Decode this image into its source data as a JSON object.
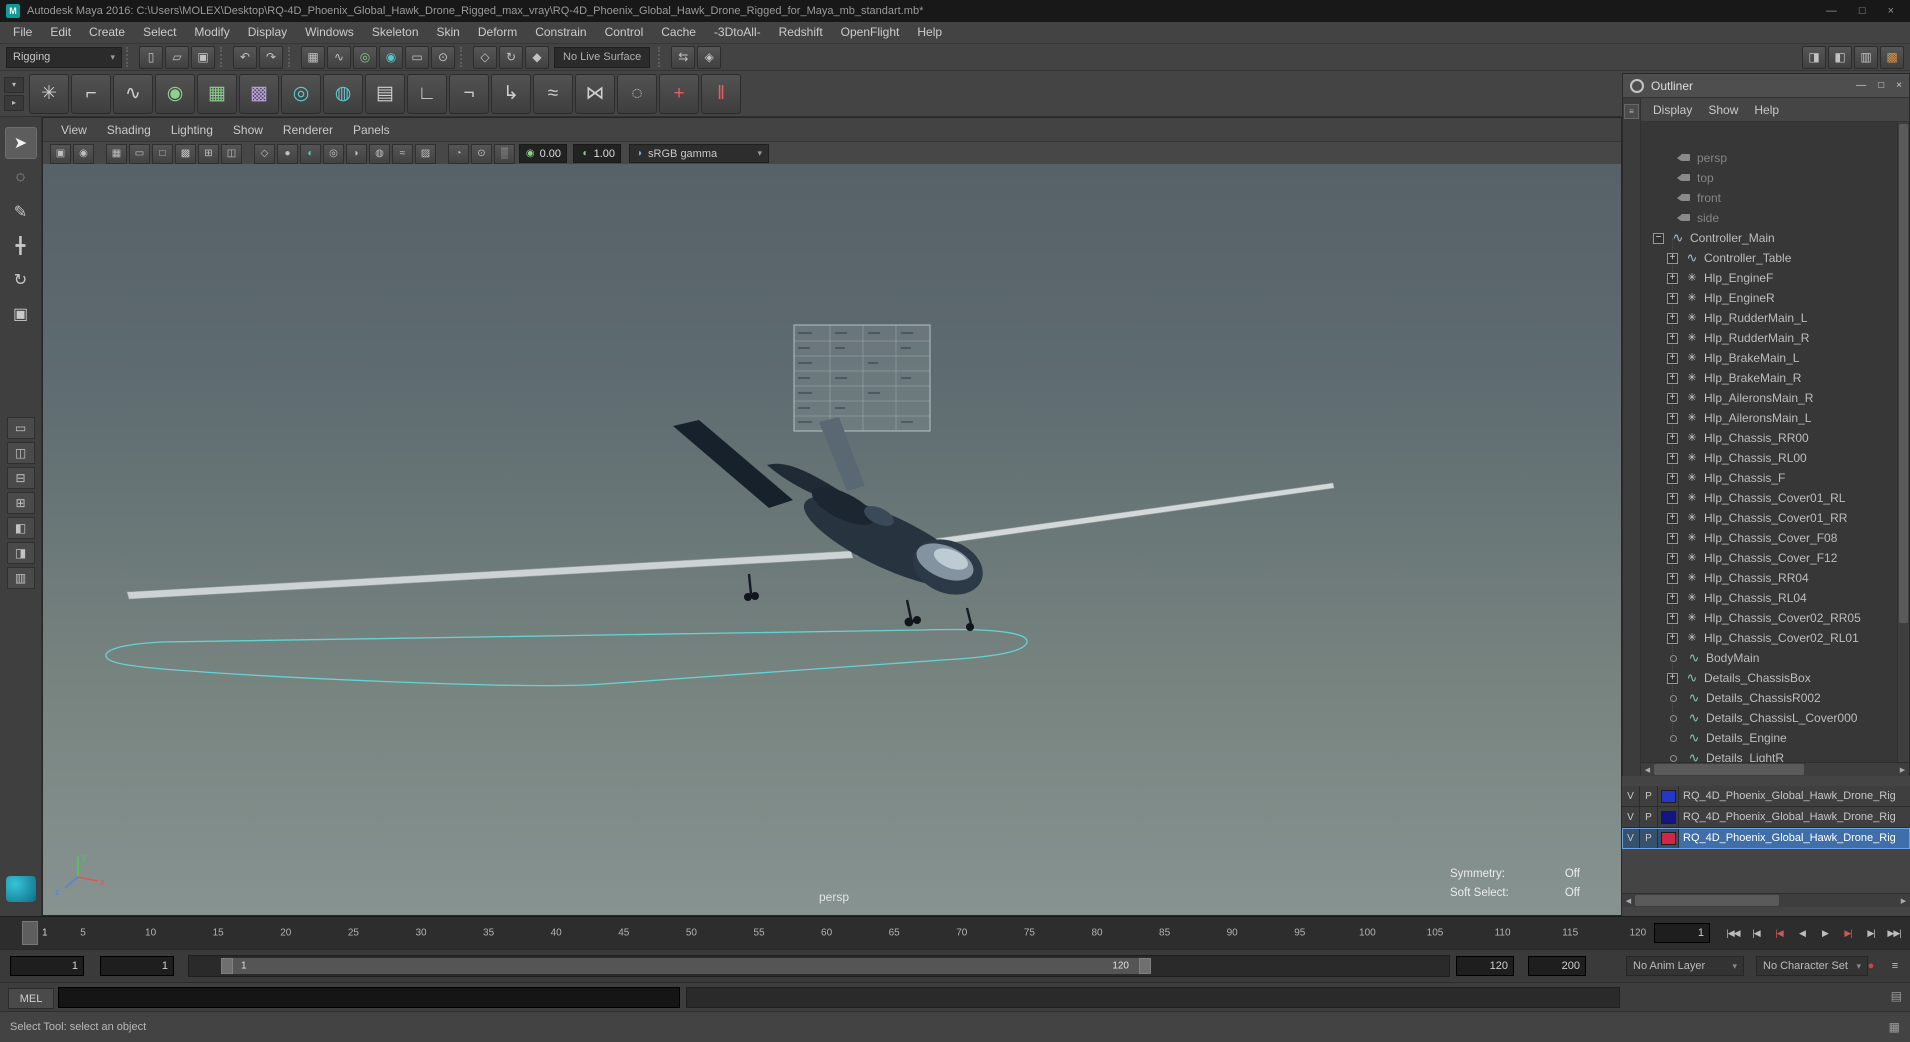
{
  "titlebar": {
    "title": "Autodesk Maya 2016: C:\\Users\\MOLEX\\Desktop\\RQ-4D_Phoenix_Global_Hawk_Drone_Rigged_max_vray\\RQ-4D_Phoenix_Global_Hawk_Drone_Rigged_for_Maya_mb_standart.mb*",
    "badge": "M",
    "minimize": "—",
    "maximize": "□",
    "close": "×"
  },
  "menubar": [
    "File",
    "Edit",
    "Create",
    "Select",
    "Modify",
    "Display",
    "Windows",
    "Skeleton",
    "Skin",
    "Deform",
    "Constrain",
    "Control",
    "Cache",
    "-3DtoAll-",
    "Redshift",
    "OpenFlight",
    "Help"
  ],
  "statusline": {
    "menuset": "Rigging",
    "items": [
      {
        "k": "sep"
      },
      {
        "k": "i",
        "n": "new-scene-icon",
        "g": "▯"
      },
      {
        "k": "i",
        "n": "open-scene-icon",
        "g": "▱"
      },
      {
        "k": "i",
        "n": "save-scene-icon",
        "g": "▣"
      },
      {
        "k": "sep"
      },
      {
        "k": "i",
        "n": "undo-icon",
        "g": "↶"
      },
      {
        "k": "i",
        "n": "redo-icon",
        "g": "↷"
      },
      {
        "k": "sep"
      },
      {
        "k": "i",
        "n": "snap-to-grids-icon",
        "g": "▦"
      },
      {
        "k": "i",
        "n": "snap-to-curves-icon",
        "g": "∿"
      },
      {
        "k": "i",
        "n": "snap-to-points-icon",
        "g": "◎",
        "t": "#7fcf7f"
      },
      {
        "k": "i",
        "n": "snap-to-projected-center-icon",
        "g": "◉",
        "t": "#56c8c8"
      },
      {
        "k": "i",
        "n": "snap-to-view-planes-icon",
        "g": "▭"
      },
      {
        "k": "i",
        "n": "make-object-live-icon",
        "g": "⊙"
      },
      {
        "k": "sep"
      },
      {
        "k": "i",
        "n": "inputs-to-selected-icon",
        "g": "◇"
      },
      {
        "k": "i",
        "n": "construction-history-icon",
        "g": "↻"
      },
      {
        "k": "i",
        "n": "outputs-from-selected-icon",
        "g": "◆"
      },
      {
        "k": "f",
        "n": "live-surface-field",
        "v": "No Live Surface"
      },
      {
        "k": "sep"
      },
      {
        "k": "i",
        "n": "symmetry-icon",
        "g": "⇆"
      },
      {
        "k": "i",
        "n": "highlight-selection-icon",
        "g": "◈"
      }
    ],
    "right_icons": [
      {
        "n": "attribute-editor-toggle-icon",
        "g": "◨"
      },
      {
        "n": "tool-settings-toggle-icon",
        "g": "◧"
      },
      {
        "n": "channel-box-toggle-icon",
        "g": "▥"
      },
      {
        "n": "modeling-toolkit-toggle-icon",
        "g": "▩",
        "t": "#d79343"
      }
    ]
  },
  "shelf": {
    "tabs": [
      {
        "n": "shelf-tab-selector-icon",
        "g": "▾"
      },
      {
        "n": "shelf-menu-icon",
        "g": "▸"
      }
    ],
    "icons": [
      {
        "n": "joint-tool-icon",
        "g": "✳"
      },
      {
        "n": "ik-handle-icon",
        "g": "⌐"
      },
      {
        "n": "ik-spline-icon",
        "g": "∿"
      },
      {
        "n": "quick-rig-icon",
        "g": "◉",
        "t": "#8fd08f"
      },
      {
        "n": "hik-skeleton-icon",
        "g": "▦",
        "t": "#8fd08f"
      },
      {
        "n": "hik-control-rig-icon",
        "g": "▩",
        "t": "#b89fe0"
      },
      {
        "n": "create-control-curve-icon",
        "g": "◎",
        "t": "#5fc9c9"
      },
      {
        "n": "geodesic-voxel-bind-icon",
        "g": "◍",
        "t": "#5fc9c9"
      },
      {
        "n": "bind-skin-icon",
        "g": "▤"
      },
      {
        "n": "unbind-skin-icon",
        "g": "∟"
      },
      {
        "n": "mirror-joint-icon",
        "g": "¬"
      },
      {
        "n": "orient-joint-icon",
        "g": "↳"
      },
      {
        "n": "paint-skin-weights-icon",
        "g": "≈"
      },
      {
        "n": "add-influence-icon",
        "g": "⋈"
      },
      {
        "n": "pose-editor-icon",
        "g": "◌"
      },
      {
        "n": "create-cluster-icon",
        "g": "+",
        "t": "#e06060"
      },
      {
        "n": "edit-membership-icon",
        "g": "‖",
        "t": "#e06060"
      }
    ]
  },
  "toolbox": {
    "tools": [
      {
        "n": "select-tool",
        "g": "➤",
        "active": true
      },
      {
        "n": "lasso-select-tool",
        "g": "◌"
      },
      {
        "n": "paint-select-tool",
        "g": "✎"
      },
      {
        "n": "move-tool",
        "g": "╋"
      },
      {
        "n": "rotate-tool",
        "g": "↻"
      },
      {
        "n": "scale-tool",
        "g": "▣"
      }
    ],
    "layouts": [
      {
        "n": "layout-single-pane",
        "g": "▭"
      },
      {
        "n": "layout-two-panes-side-by-side",
        "g": "◫"
      },
      {
        "n": "layout-two-panes-stacked",
        "g": "⊟"
      },
      {
        "n": "layout-four-panes",
        "g": "⊞"
      },
      {
        "n": "layout-three-panes-split-top",
        "g": "◧"
      },
      {
        "n": "layout-three-panes-split-left",
        "g": "◨"
      },
      {
        "n": "layout-outliner-persp",
        "g": "▥"
      }
    ]
  },
  "panel_menu": [
    "View",
    "Shading",
    "Lighting",
    "Show",
    "Renderer",
    "Panels"
  ],
  "viewport_bar": {
    "exposure": "0.00",
    "gamma": "1.00",
    "view_transform": "sRGB gamma",
    "groups": [
      [
        {
          "n": "select-camera-icon",
          "g": "▣"
        },
        {
          "n": "lock-camera-icon",
          "g": "◉"
        }
      ],
      [
        {
          "n": "grid-icon",
          "g": "▦"
        },
        {
          "n": "film-gate-icon",
          "g": "▭"
        },
        {
          "n": "resolution-gate-icon",
          "g": "□"
        },
        {
          "n": "gate-mask-icon",
          "g": "▩"
        },
        {
          "n": "field-chart-icon",
          "g": "⊞"
        },
        {
          "n": "safe-action-icon",
          "g": "◫"
        }
      ],
      [
        {
          "n": "wireframe-icon",
          "g": "◇"
        },
        {
          "n": "smooth-shade-icon",
          "g": "●"
        },
        {
          "n": "textured-icon",
          "g": "◐",
          "t": "#58c8c8"
        },
        {
          "n": "use-all-lights-icon",
          "g": "◎"
        },
        {
          "n": "shadows-icon",
          "g": "◗"
        },
        {
          "n": "ssao-icon",
          "g": "◍"
        },
        {
          "n": "motion-blur-icon",
          "g": "≈"
        },
        {
          "n": "anti-aliasing-icon",
          "g": "▨"
        }
      ],
      [
        {
          "n": "xray-icon",
          "g": "◔"
        },
        {
          "n": "isolate-select-icon",
          "g": "⊙"
        },
        {
          "n": "fog-icon",
          "g": "▒"
        }
      ]
    ]
  },
  "viewport": {
    "camera": "persp",
    "hud": [
      {
        "label": "Symmetry:",
        "value": "Off"
      },
      {
        "label": "Soft Select:",
        "value": "Off"
      }
    ]
  },
  "outliner": {
    "title": "Outliner",
    "minimize": "—",
    "maximize": "□",
    "close": "×",
    "menus": [
      "Display",
      "Show",
      "Help"
    ],
    "items": [
      {
        "label": "persp",
        "icon": "camera",
        "level": "cam",
        "expand": "none"
      },
      {
        "label": "top",
        "icon": "camera",
        "level": "cam",
        "expand": "none"
      },
      {
        "label": "front",
        "icon": "camera",
        "level": "cam",
        "expand": "none"
      },
      {
        "label": "side",
        "icon": "camera",
        "level": "cam",
        "expand": "none"
      },
      {
        "label": "Controller_Main",
        "icon": "curve",
        "level": "root",
        "expand": "minus"
      },
      {
        "label": "Controller_Table",
        "icon": "curve",
        "level": "child",
        "expand": "plus"
      },
      {
        "label": "Hlp_EngineF",
        "icon": "locator",
        "level": "child",
        "expand": "plus"
      },
      {
        "label": "Hlp_EngineR",
        "icon": "locator",
        "level": "child",
        "expand": "plus"
      },
      {
        "label": "Hlp_RudderMain_L",
        "icon": "locator",
        "level": "child",
        "expand": "plus"
      },
      {
        "label": "Hlp_RudderMain_R",
        "icon": "locator",
        "level": "child",
        "expand": "plus"
      },
      {
        "label": "Hlp_BrakeMain_L",
        "icon": "locator",
        "level": "child",
        "expand": "plus"
      },
      {
        "label": "Hlp_BrakeMain_R",
        "icon": "locator",
        "level": "child",
        "expand": "plus"
      },
      {
        "label": "Hlp_AileronsMain_R",
        "icon": "locator",
        "level": "child",
        "expand": "plus"
      },
      {
        "label": "Hlp_AileronsMain_L",
        "icon": "locator",
        "level": "child",
        "expand": "plus"
      },
      {
        "label": "Hlp_Chassis_RR00",
        "icon": "locator",
        "level": "child",
        "expand": "plus"
      },
      {
        "label": "Hlp_Chassis_RL00",
        "icon": "locator",
        "level": "child",
        "expand": "plus"
      },
      {
        "label": "Hlp_Chassis_F",
        "icon": "locator",
        "level": "child",
        "expand": "plus"
      },
      {
        "label": "Hlp_Chassis_Cover01_RL",
        "icon": "locator",
        "level": "child",
        "expand": "plus"
      },
      {
        "label": "Hlp_Chassis_Cover01_RR",
        "icon": "locator",
        "level": "child",
        "expand": "plus"
      },
      {
        "label": "Hlp_Chassis_Cover_F08",
        "icon": "locator",
        "level": "child",
        "expand": "plus"
      },
      {
        "label": "Hlp_Chassis_Cover_F12",
        "icon": "locator",
        "level": "child",
        "expand": "plus"
      },
      {
        "label": "Hlp_Chassis_RR04",
        "icon": "locator",
        "level": "child",
        "expand": "plus"
      },
      {
        "label": "Hlp_Chassis_RL04",
        "icon": "locator",
        "level": "child",
        "expand": "plus"
      },
      {
        "label": "Hlp_Chassis_Cover02_RR05",
        "icon": "locator",
        "level": "child",
        "expand": "plus"
      },
      {
        "label": "Hlp_Chassis_Cover02_RL01",
        "icon": "locator",
        "level": "child",
        "expand": "plus"
      },
      {
        "label": "BodyMain",
        "icon": "mesh",
        "level": "child",
        "expand": "leaf"
      },
      {
        "label": "Details_ChassisBox",
        "icon": "mesh",
        "level": "child",
        "expand": "plus"
      },
      {
        "label": "Details_ChassisR002",
        "icon": "mesh",
        "level": "child",
        "expand": "leaf"
      },
      {
        "label": "Details_ChassisL_Cover000",
        "icon": "mesh",
        "level": "child",
        "expand": "leaf"
      },
      {
        "label": "Details_Engine",
        "icon": "mesh",
        "level": "child",
        "expand": "leaf"
      },
      {
        "label": "Details_LightR",
        "icon": "mesh",
        "level": "child",
        "expand": "leaf"
      }
    ]
  },
  "layer_editor": {
    "rows": [
      {
        "v": "V",
        "p": "P",
        "color": "#2438c8",
        "name": "RQ_4D_Phoenix_Global_Hawk_Drone_Rig",
        "selected": false
      },
      {
        "v": "V",
        "p": "P",
        "color": "#141583",
        "name": "RQ_4D_Phoenix_Global_Hawk_Drone_Rig",
        "selected": false
      },
      {
        "v": "V",
        "p": "P",
        "color": "#cf2745",
        "name": "RQ_4D_Phoenix_Global_Hawk_Drone_Rig",
        "selected": true
      }
    ]
  },
  "timeline": {
    "current": "1",
    "current_field": "1",
    "ticks": [
      "5",
      "10",
      "15",
      "20",
      "25",
      "30",
      "35",
      "40",
      "45",
      "50",
      "55",
      "60",
      "65",
      "70",
      "75",
      "80",
      "85",
      "90",
      "95",
      "100",
      "105",
      "110",
      "115",
      "120"
    ],
    "playback": [
      {
        "n": "go-to-start-button",
        "g": "|◀◀"
      },
      {
        "n": "step-back-frame-button",
        "g": "|◀"
      },
      {
        "n": "step-back-key-button",
        "g": "|◀",
        "red": true
      },
      {
        "n": "play-backwards-button",
        "g": "◀"
      },
      {
        "n": "play-forwards-button",
        "g": "▶"
      },
      {
        "n": "step-forward-key-button",
        "g": "▶|",
        "red": true
      },
      {
        "n": "step-forward-frame-button",
        "g": "▶|"
      },
      {
        "n": "go-to-end-button",
        "g": "▶▶|"
      }
    ]
  },
  "range_slider": {
    "animation_start": "1",
    "playback_start": "1",
    "bar_start_label": "1",
    "bar_end_label": "120",
    "playback_end": "120",
    "animation_end": "200",
    "anim_layer": "No Anim Layer",
    "character_set": "No Character Set",
    "icons": [
      {
        "n": "auto-keyframe-toggle-icon",
        "g": "●",
        "t": "#cc4444"
      },
      {
        "n": "animation-preferences-icon",
        "g": "≡"
      }
    ]
  },
  "command_line": {
    "label": "MEL",
    "icon": "▤"
  },
  "help_line": {
    "text": "Select Tool: select an object",
    "icon": "▦"
  }
}
